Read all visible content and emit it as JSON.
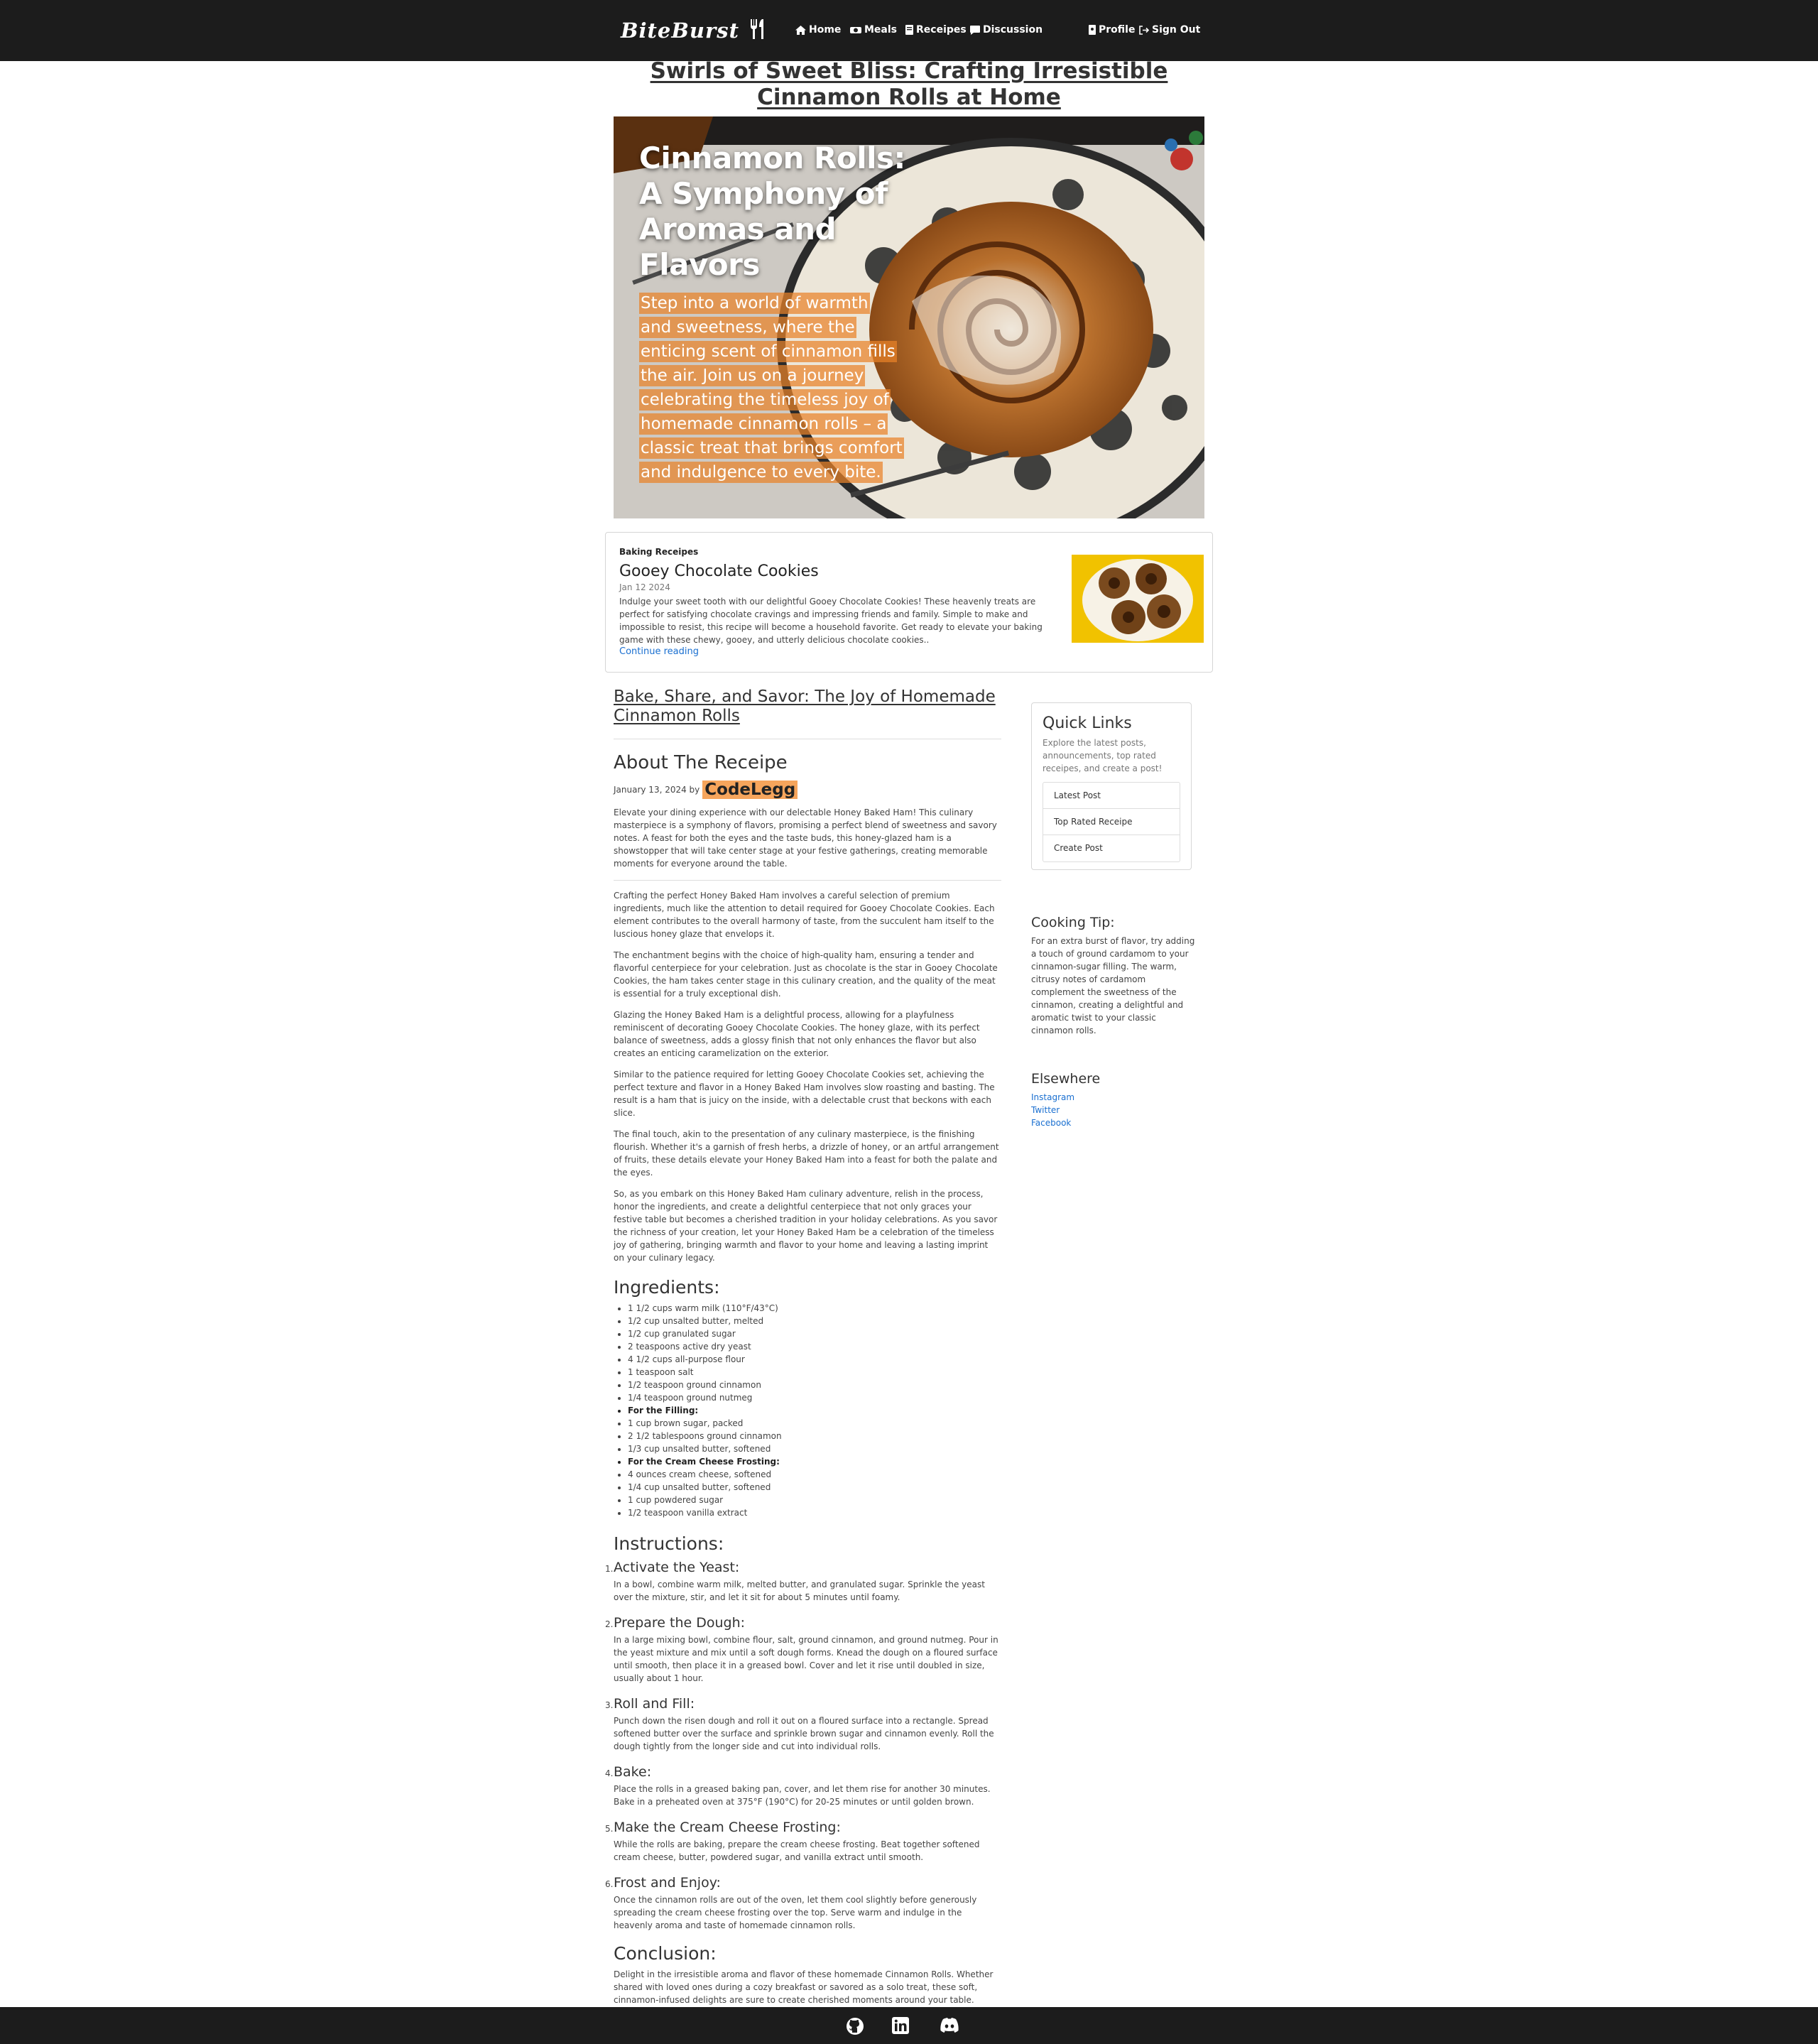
{
  "nav": {
    "brand": "BiteBurst",
    "items": [
      {
        "label": "Home",
        "icon": "home-icon"
      },
      {
        "label": "Meals",
        "icon": "utensils-icon"
      },
      {
        "label": "Receipes",
        "icon": "book-icon"
      },
      {
        "label": "Discussion",
        "icon": "comment-icon"
      }
    ],
    "profile": "Profile",
    "signout": "Sign Out"
  },
  "page": {
    "title": "Swirls of Sweet Bliss: Crafting Irresistible Cinnamon Rolls at Home"
  },
  "hero": {
    "title": "Cinnamon Rolls: A Symphony of Aromas and Flavors",
    "description": "Step into a world of warmth and sweetness, where the enticing scent of cinnamon fills the air. Join us on a journey celebrating the timeless joy of homemade cinnamon rolls – a classic treat that brings comfort and indulgence to every bite."
  },
  "featured": {
    "category": "Baking Receipes",
    "title": "Gooey Chocolate Cookies",
    "date": "Jan 12 2024",
    "text": "Indulge your sweet tooth with our delightful Gooey Chocolate Cookies! These heavenly treats are perfect for satisfying chocolate cravings and impressing friends and family. Simple to make and impossible to resist, this recipe will become a household favorite. Get ready to elevate your baking game with these chewy, gooey, and utterly delicious chocolate cookies..",
    "link": "Continue reading"
  },
  "article": {
    "section_title": "Bake, Share, and Savor: The Joy of Homemade Cinnamon Rolls",
    "about_title": "About The Receipe",
    "date_prefix": "January 13, 2024 by",
    "author": "CodeLegg",
    "intro": "Elevate your dining experience with our delectable Honey Baked Ham! This culinary masterpiece is a symphony of flavors, promising a perfect blend of sweetness and savory notes. A feast for both the eyes and the taste buds, this honey-glazed ham is a showstopper that will take center stage at your festive gatherings, creating memorable moments for everyone around the table.",
    "paragraphs": [
      "Crafting the perfect Honey Baked Ham involves a careful selection of premium ingredients, much like the attention to detail required for Gooey Chocolate Cookies. Each element contributes to the overall harmony of taste, from the succulent ham itself to the luscious honey glaze that envelops it.",
      "The enchantment begins with the choice of high-quality ham, ensuring a tender and flavorful centerpiece for your celebration. Just as chocolate is the star in Gooey Chocolate Cookies, the ham takes center stage in this culinary creation, and the quality of the meat is essential for a truly exceptional dish.",
      "Glazing the Honey Baked Ham is a delightful process, allowing for a playfulness reminiscent of decorating Gooey Chocolate Cookies. The honey glaze, with its perfect balance of sweetness, adds a glossy finish that not only enhances the flavor but also creates an enticing caramelization on the exterior.",
      "Similar to the patience required for letting Gooey Chocolate Cookies set, achieving the perfect texture and flavor in a Honey Baked Ham involves slow roasting and basting. The result is a ham that is juicy on the inside, with a delectable crust that beckons with each slice.",
      "The final touch, akin to the presentation of any culinary masterpiece, is the finishing flourish. Whether it's a garnish of fresh herbs, a drizzle of honey, or an artful arrangement of fruits, these details elevate your Honey Baked Ham into a feast for both the palate and the eyes.",
      "So, as you embark on this Honey Baked Ham culinary adventure, relish in the process, honor the ingredients, and create a delightful centerpiece that not only graces your festive table but becomes a cherished tradition in your holiday celebrations. As you savor the richness of your creation, let your Honey Baked Ham be a celebration of the timeless joy of gathering, bringing warmth and flavor to your home and leaving a lasting imprint on your culinary legacy."
    ],
    "ingredients_title": "Ingredients:",
    "ingredients": [
      "1 1/2 cups warm milk (110°F/43°C)",
      "1/2 cup unsalted butter, melted",
      "1/2 cup granulated sugar",
      "2 teaspoons active dry yeast",
      "4 1/2 cups all-purpose flour",
      "1 teaspoon salt",
      "1/2 teaspoon ground cinnamon",
      "1/4 teaspoon ground nutmeg",
      "For the Filling:",
      "1 cup brown sugar, packed",
      "2 1/2 tablespoons ground cinnamon",
      "1/3 cup unsalted butter, softened",
      "For the Cream Cheese Frosting:",
      "4 ounces cream cheese, softened",
      "1/4 cup unsalted butter, softened",
      "1 cup powdered sugar",
      "1/2 teaspoon vanilla extract"
    ],
    "instructions_title": "Instructions:",
    "steps": [
      {
        "title": "Activate the Yeast:",
        "text": "In a bowl, combine warm milk, melted butter, and granulated sugar. Sprinkle the yeast over the mixture, stir, and let it sit for about 5 minutes until foamy."
      },
      {
        "title": "Prepare the Dough:",
        "text": "In a large mixing bowl, combine flour, salt, ground cinnamon, and ground nutmeg. Pour in the yeast mixture and mix until a soft dough forms. Knead the dough on a floured surface until smooth, then place it in a greased bowl. Cover and let it rise until doubled in size, usually about 1 hour."
      },
      {
        "title": "Roll and Fill:",
        "text": "Punch down the risen dough and roll it out on a floured surface into a rectangle. Spread softened butter over the surface and sprinkle brown sugar and cinnamon evenly. Roll the dough tightly from the longer side and cut into individual rolls."
      },
      {
        "title": "Bake:",
        "text": "Place the rolls in a greased baking pan, cover, and let them rise for another 30 minutes. Bake in a preheated oven at 375°F (190°C) for 20-25 minutes or until golden brown."
      },
      {
        "title": "Make the Cream Cheese Frosting:",
        "text": "While the rolls are baking, prepare the cream cheese frosting. Beat together softened cream cheese, butter, powdered sugar, and vanilla extract until smooth."
      },
      {
        "title": "Frost and Enjoy:",
        "text": "Once the cinnamon rolls are out of the oven, let them cool slightly before generously spreading the cream cheese frosting over the top. Serve warm and indulge in the heavenly aroma and taste of homemade cinnamon rolls."
      }
    ],
    "conclusion_title": "Conclusion:",
    "conclusion": "Delight in the irresistible aroma and flavor of these homemade Cinnamon Rolls. Whether shared with loved ones during a cozy breakfast or savored as a solo treat, these soft, cinnamon-infused delights are sure to create cherished moments around your table. Here's to the joy of baking and the sweet memories it brings!"
  },
  "sidebar": {
    "quick_links_title": "Quick Links",
    "quick_links_desc": "Explore the latest posts, announcements, top rated receipes, and create a post!",
    "links": [
      "Latest Post",
      "Top Rated Receipe",
      "Create Post"
    ],
    "tip_title": "Cooking Tip:",
    "tip_text": "For an extra burst of flavor, try adding a touch of ground cardamom to your cinnamon-sugar filling. The warm, citrusy notes of cardamom complement the sweetness of the cinnamon, creating a delightful and aromatic twist to your classic cinnamon rolls.",
    "elsewhere_title": "Elsewhere",
    "elsewhere": [
      "Instagram",
      "Twitter",
      "Facebook"
    ]
  },
  "footer": {
    "icons": [
      "github-icon",
      "linkedin-icon",
      "discord-icon"
    ]
  }
}
